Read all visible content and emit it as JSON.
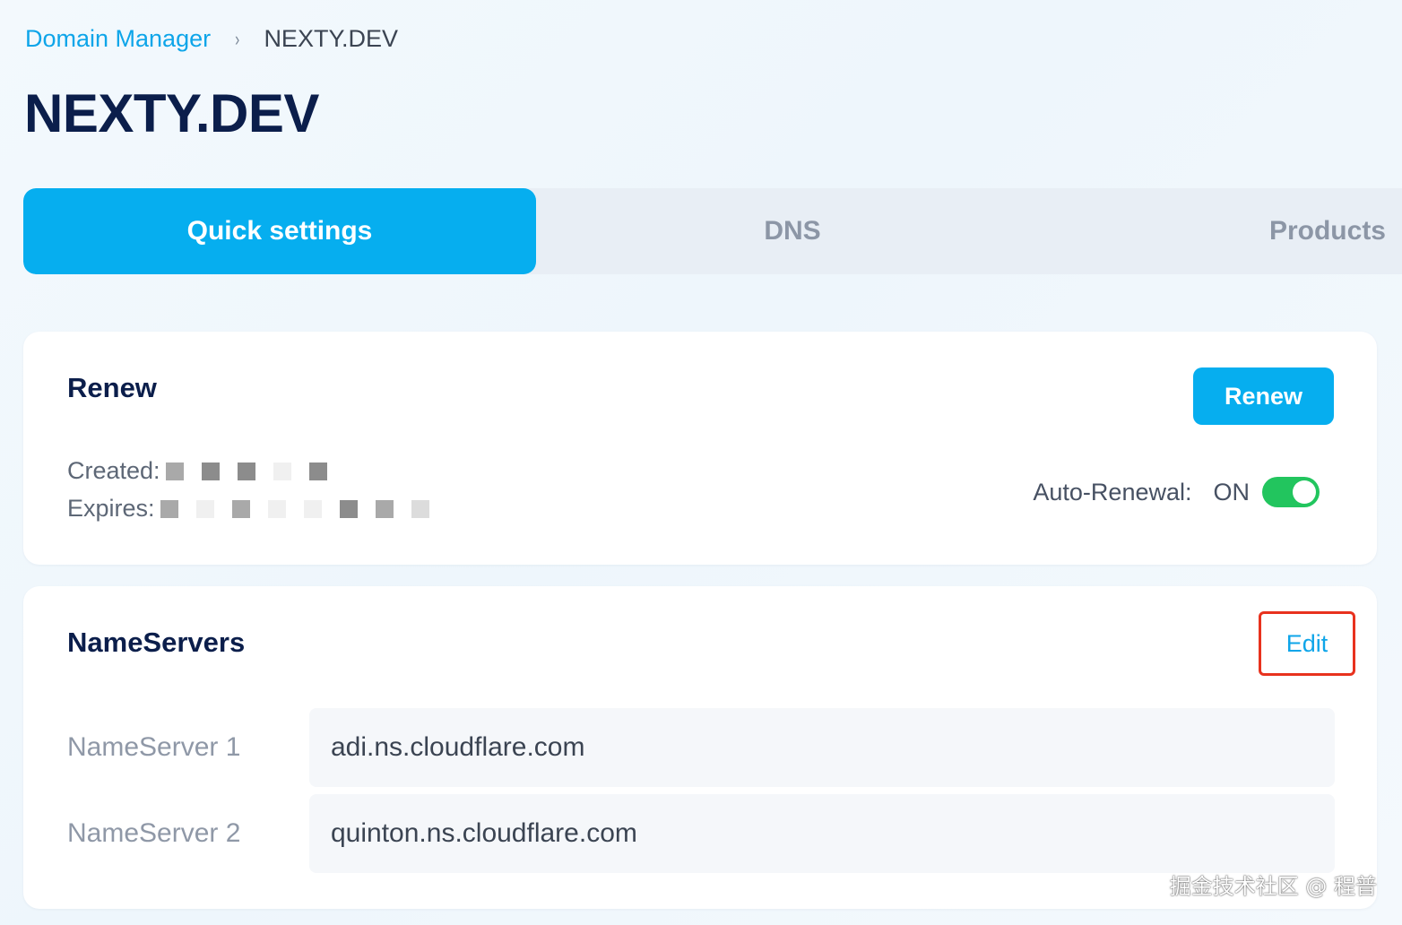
{
  "breadcrumb": {
    "root": "Domain Manager",
    "separator": "›",
    "current": "NEXTY.DEV"
  },
  "page": {
    "title": "NEXTY.DEV"
  },
  "tabs": [
    {
      "label": "Quick settings",
      "active": true
    },
    {
      "label": "DNS",
      "active": false
    },
    {
      "label": "Products",
      "active": false
    }
  ],
  "renew": {
    "title": "Renew",
    "button_label": "Renew",
    "created_label": "Created:",
    "expires_label": "Expires:",
    "auto_renewal_label": "Auto-Renewal:",
    "auto_renewal_value": "ON",
    "auto_renewal_enabled": true
  },
  "nameservers": {
    "title": "NameServers",
    "edit_label": "Edit",
    "items": [
      {
        "label": "NameServer 1",
        "value": "adi.ns.cloudflare.com"
      },
      {
        "label": "NameServer 2",
        "value": "quinton.ns.cloudflare.com"
      }
    ]
  },
  "watermark": "掘金技术社区 @ 程普",
  "colors": {
    "accent": "#06aeef",
    "title": "#0b1e4b",
    "toggle_on": "#22c55e",
    "highlight_box": "#e8321e"
  }
}
